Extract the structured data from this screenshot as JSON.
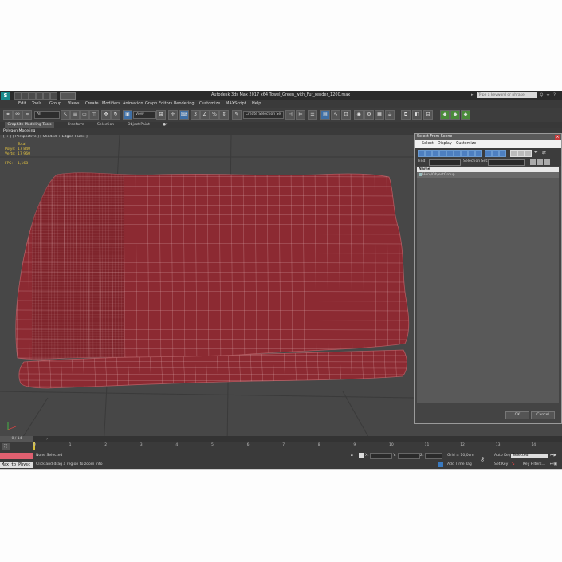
{
  "window": {
    "title": "Autodesk 3ds Max  2017 x64     Towel_Green_with_Fur_render_1200.max",
    "logo": "S",
    "search_placeholder": "Type a keyword or phrase"
  },
  "menu": [
    "Edit",
    "Tools",
    "Group",
    "Views",
    "Create",
    "Modifiers",
    "Animation",
    "Graph Editors",
    "Rendering",
    "Customize",
    "MAXScript",
    "Help"
  ],
  "toolbar": {
    "selection_filter": "All",
    "view_dropdown": "View",
    "named_selection": "Create Selection Se"
  },
  "ribbon": {
    "tabs": [
      "Graphite Modeling Tools",
      "Freeform",
      "Selection",
      "Object Paint"
    ],
    "active_tab": "Graphite Modeling Tools",
    "subtitle": "Polygon Modeling"
  },
  "viewport": {
    "label": "[ + ] [ Perspective ] [ Shaded + Edged Faces ]",
    "stats": {
      "total_label": "Total",
      "polys_label": "Polys:",
      "polys_value": "17 840",
      "verts_label": "Verts:",
      "verts_value": "17 960",
      "fps_label": "FPS:",
      "fps_value": "1,168"
    },
    "object_color": "#8c2a32",
    "wire_color": "#d9a7ab"
  },
  "dialog": {
    "title": "Select From Scene",
    "menu": [
      "Select",
      "Display",
      "Customize"
    ],
    "find_label": "Find:",
    "selection_set_label": "Selection Set:",
    "column_header": "Name",
    "items": [
      "Hero/ObjectGroup"
    ],
    "ok_label": "OK",
    "cancel_label": "Cancel"
  },
  "timeline": {
    "slider": "0 / 14",
    "ticks": [
      "0",
      "1",
      "2",
      "3",
      "4",
      "5",
      "6",
      "7",
      "8",
      "9",
      "10",
      "11",
      "12",
      "13",
      "14"
    ]
  },
  "statusbar": {
    "maxscript": "Max to Physc",
    "selection_status": "None Selected",
    "prompt": "Click and drag a region to zoom into",
    "x_label": "X:",
    "y_label": "Y:",
    "z_label": "Z:",
    "grid": "Grid = 10,0cm",
    "add_time_tag": "Add Time Tag",
    "auto_key": "Auto Key",
    "set_key": "Set Key",
    "selected": "Selected",
    "key_filters": "Key Filters..."
  }
}
